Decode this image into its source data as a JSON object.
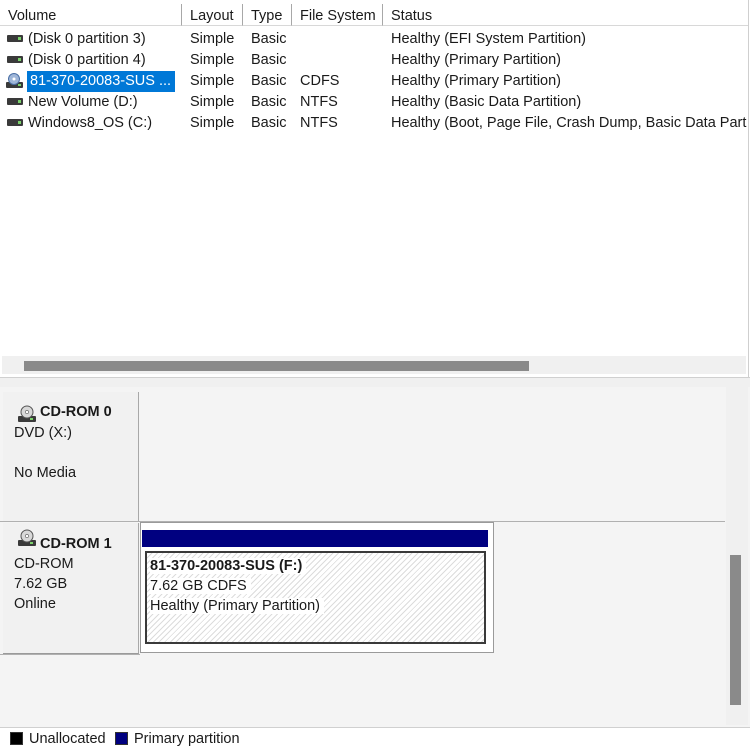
{
  "columns": {
    "volume": "Volume",
    "layout": "Layout",
    "type": "Type",
    "file_system": "File System",
    "status": "Status"
  },
  "volumes": [
    {
      "name": "(Disk 0 partition 3)",
      "layout": "Simple",
      "type": "Basic",
      "fs": "",
      "status": "Healthy (EFI System Partition)",
      "icon": "drive-icon"
    },
    {
      "name": "(Disk 0 partition 4)",
      "layout": "Simple",
      "type": "Basic",
      "fs": "",
      "status": "Healthy (Primary Partition)",
      "icon": "drive-icon"
    },
    {
      "name": "81-370-20083-SUS ...",
      "layout": "Simple",
      "type": "Basic",
      "fs": "CDFS",
      "status": "Healthy (Primary Partition)",
      "icon": "cd-icon",
      "selected": true
    },
    {
      "name": "New Volume (D:)",
      "layout": "Simple",
      "type": "Basic",
      "fs": "NTFS",
      "status": "Healthy (Basic Data Partition)",
      "icon": "drive-icon"
    },
    {
      "name": "Windows8_OS (C:)",
      "layout": "Simple",
      "type": "Basic",
      "fs": "NTFS",
      "status": "Healthy (Boot, Page File, Crash Dump, Basic Data Part",
      "icon": "drive-icon"
    }
  ],
  "disks": [
    {
      "title": "CD-ROM 0",
      "line1": "DVD (X:)",
      "line2": "",
      "line3": "No Media"
    },
    {
      "title": "CD-ROM 1",
      "line1": "CD-ROM",
      "line2": "7.62 GB",
      "line3": "Online"
    }
  ],
  "partition": {
    "name": "81-370-20083-SUS  (F:)",
    "size_fs": "7.62 GB CDFS",
    "status": "Healthy (Primary Partition)"
  },
  "legend": {
    "unallocated": "Unallocated",
    "primary": "Primary partition"
  },
  "colors": {
    "selection": "#0078d7",
    "primary_partition": "#000080",
    "unallocated": "#000000"
  }
}
